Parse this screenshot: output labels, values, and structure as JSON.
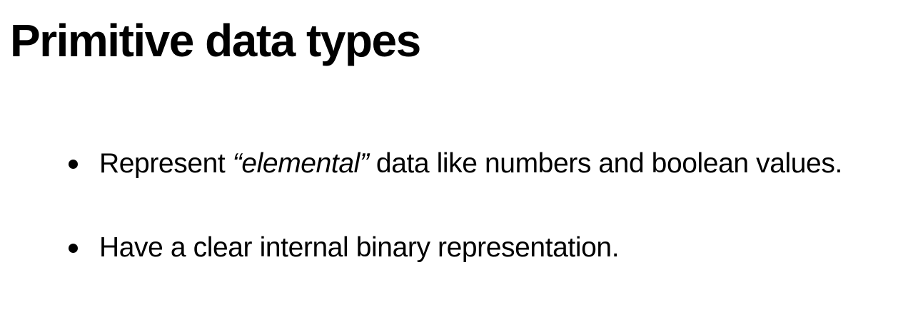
{
  "slide": {
    "title": "Primitive data types",
    "bullets": [
      {
        "before": "Represent ",
        "emphasis": "“elemental”",
        "after": " data like numbers and boolean values."
      },
      {
        "before": "Have a clear internal binary representation.",
        "emphasis": "",
        "after": ""
      }
    ]
  }
}
